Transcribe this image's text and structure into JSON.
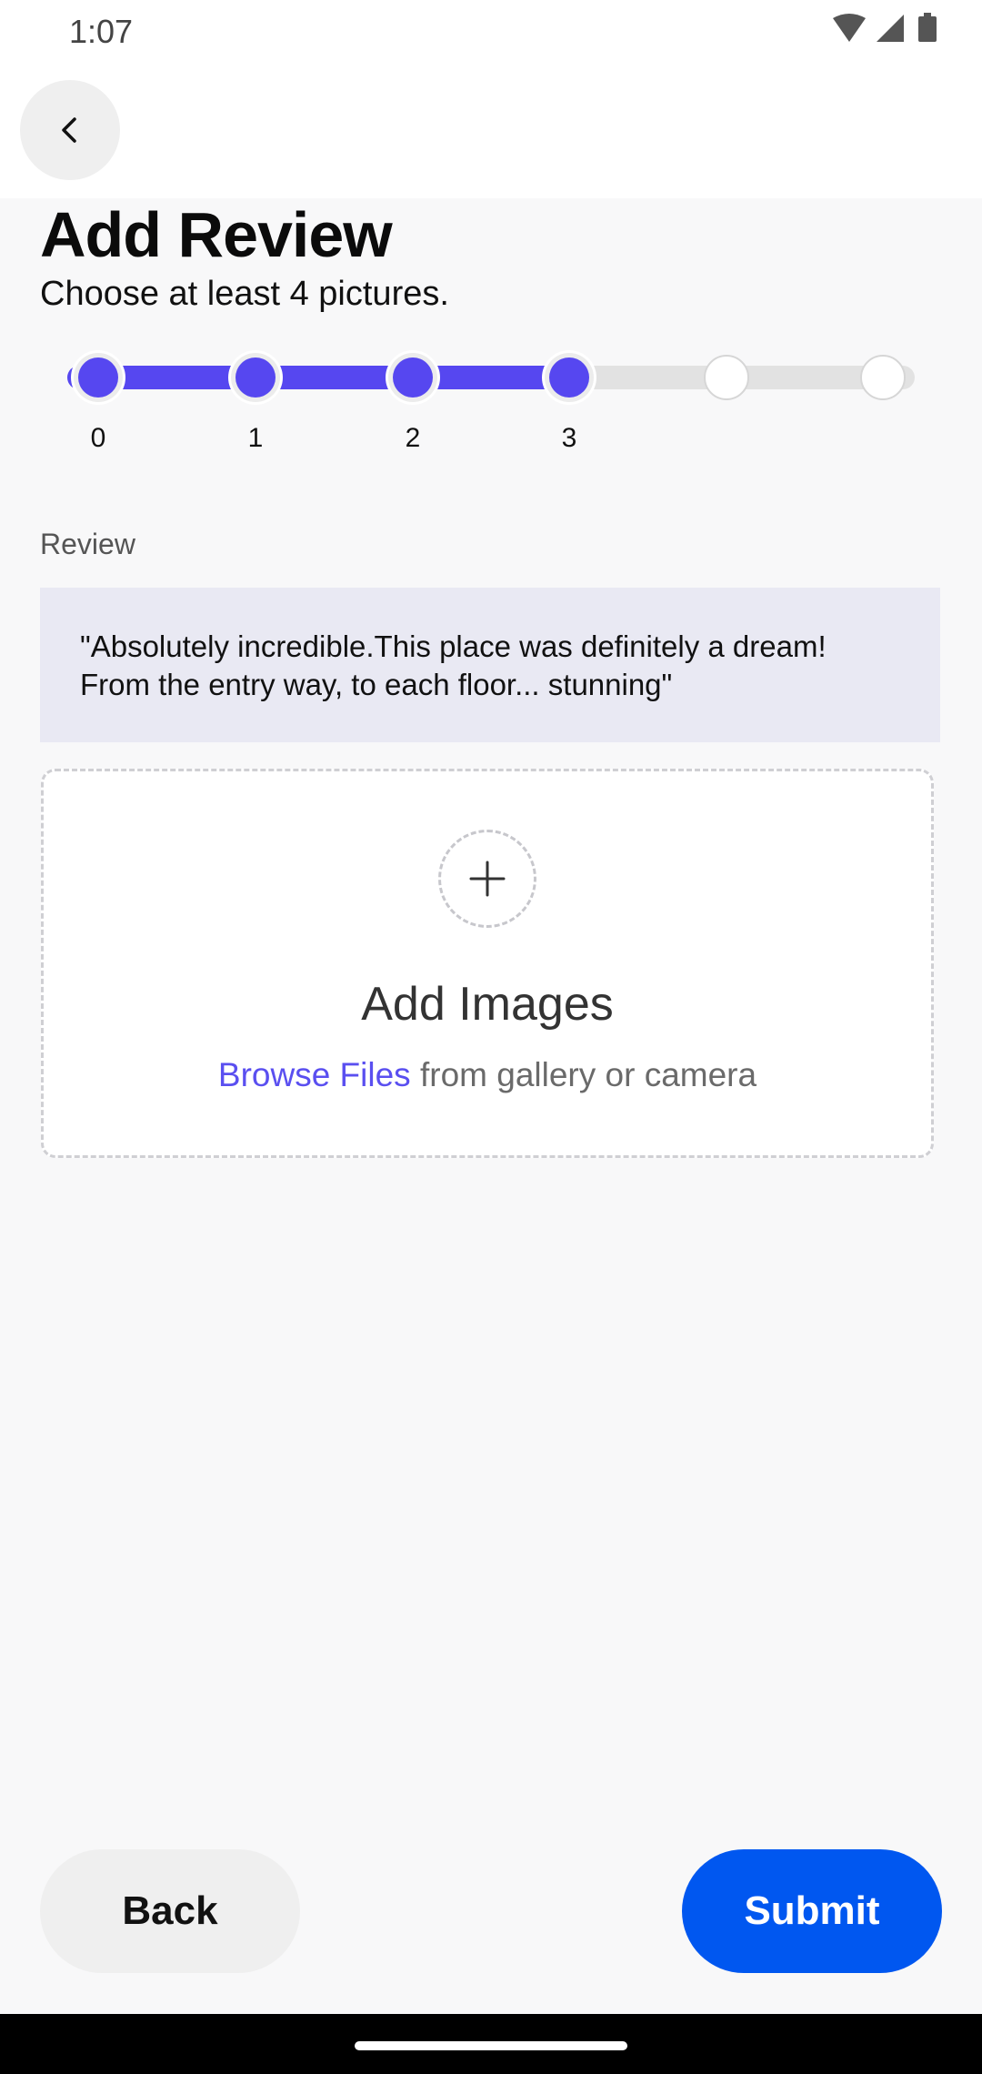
{
  "status_bar": {
    "time": "1:07",
    "icons": [
      "wifi-icon",
      "signal-icon",
      "battery-icon"
    ]
  },
  "header": {
    "back_icon": "chevron-left-icon"
  },
  "page": {
    "title": "Add Review",
    "subtitle": "Choose at least 4 pictures."
  },
  "stepper": {
    "labels": [
      "0",
      "1",
      "2",
      "3"
    ],
    "total_steps": 6,
    "completed_steps": 4,
    "active_color": "#5647f0",
    "inactive_color": "#e2e2e2"
  },
  "review": {
    "label": "Review",
    "line1": "\"Absolutely incredible.This place was definitely a dream!",
    "line2": "From the entry way, to each floor... stunning\""
  },
  "dropzone": {
    "icon": "plus-icon",
    "title": "Add Images",
    "link_text": "Browse Files",
    "rest_text": " from gallery or camera"
  },
  "buttons": {
    "back_label": "Back",
    "submit_label": "Submit",
    "submit_color": "#0057f0"
  }
}
